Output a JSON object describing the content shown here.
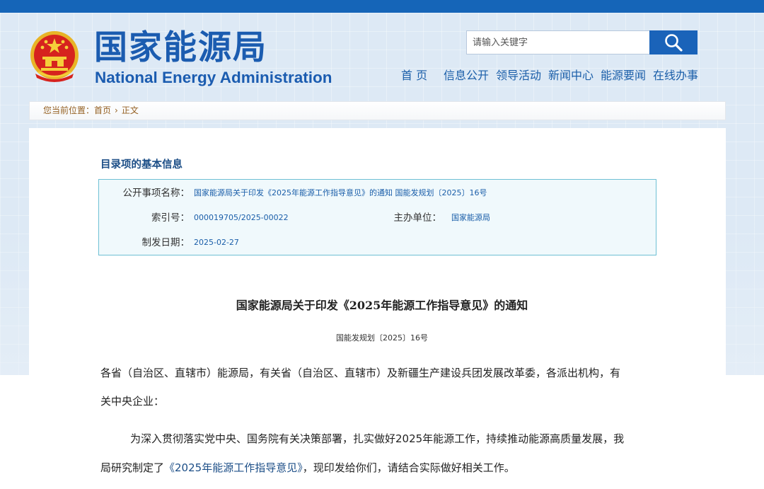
{
  "header": {
    "site_title_cn": "国家能源局",
    "site_title_en": "National Energy Administration",
    "search_placeholder": "请输入关键字",
    "nav": [
      "首 页",
      "信息公开",
      "领导活动",
      "新闻中心",
      "能源要闻",
      "在线办事"
    ]
  },
  "breadcrumb": {
    "prefix": "您当前位置：",
    "home": "首页",
    "separator": "›",
    "current": "正文"
  },
  "catalog": {
    "heading": "目录项的基本信息",
    "name_label": "公开事项名称：",
    "name_value": "国家能源局关于印发《2025年能源工作指导意见》的通知 国能发规划〔2025〕16号",
    "index_label": "索引号：",
    "index_value": "000019705/2025-00022",
    "org_label": "主办单位：",
    "org_value": "国家能源局",
    "date_label": "制发日期：",
    "date_value": "2025-02-27"
  },
  "document": {
    "title": "国家能源局关于印发《2025年能源工作指导意见》的通知",
    "number": "国能发规划〔2025〕16号",
    "para1_line1": "各省（自治区、直辖市）能源局，有关省（自治区、直辖市）及新疆生产建设兵团发展改革委，各派出机构，有",
    "para1_line2": "关中央企业：",
    "para2_line1": "为深入贯彻落实党中央、国务院有关决策部署，扎实做好2025年能源工作，持续推动能源高质量发展，我",
    "para2_line2_prefix": "局研究制定了",
    "para2_line2_link": "《2025年能源工作指导意见》",
    "para2_line2_suffix": "，现印发给你们，请结合实际做好相关工作。"
  },
  "colors": {
    "brand_blue": "#1b5cb0",
    "top_bar": "#1565b8",
    "breadcrumb_text": "#946022",
    "info_border": "#6ec0d4",
    "info_bg": "#f0f9fc"
  }
}
